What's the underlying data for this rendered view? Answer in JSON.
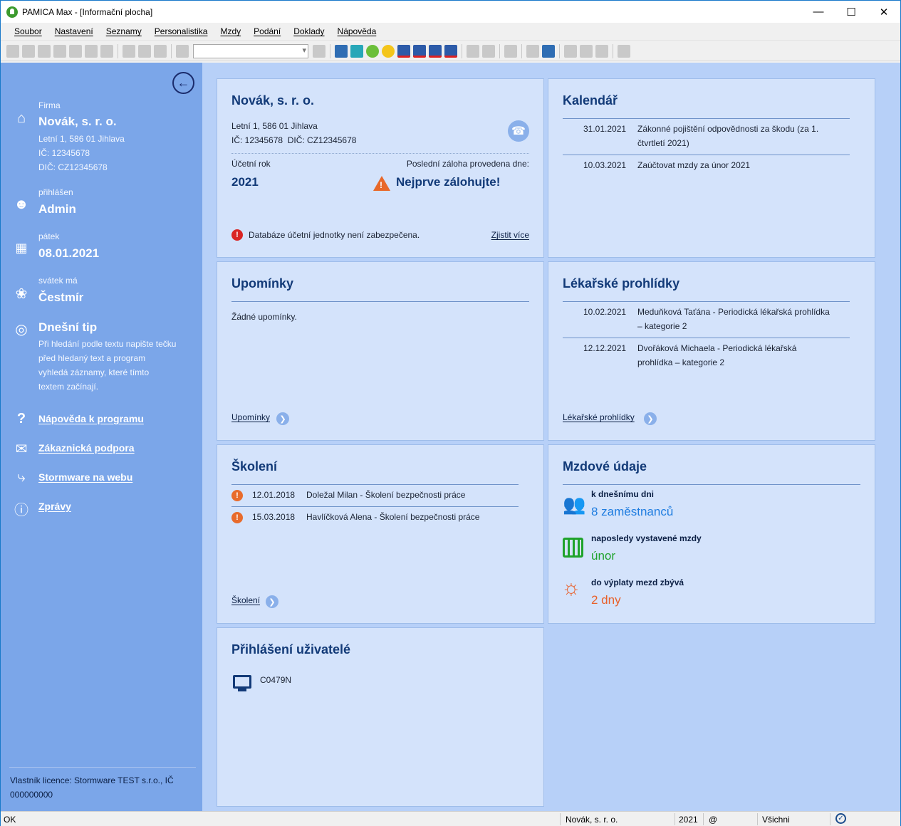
{
  "window": {
    "title": "PAMICA Max - [Informační plocha]",
    "minimize": "—",
    "maximize": "☐",
    "close": "✕"
  },
  "menu": [
    "Soubor",
    "Nastavení",
    "Seznamy",
    "Personalistika",
    "Mzdy",
    "Podání",
    "Doklady",
    "Nápověda"
  ],
  "sidebar": {
    "firm_label": "Firma",
    "firm_name": "Novák, s. r. o.",
    "firm_address": "Letní 1, 586 01 Jihlava",
    "firm_ic": "IČ: 12345678",
    "firm_dic": "DIČ: CZ12345678",
    "user_label": "přihlášen",
    "user_name": "Admin",
    "day_label": "pátek",
    "date": "08.01.2021",
    "nameday_label": "svátek má",
    "nameday": "Čestmír",
    "tip_title": "Dnešní tip",
    "tip_lines": [
      "Při hledání podle textu napište tečku",
      "před hledaný text a program",
      "vyhledá záznamy, které tímto",
      "textem začínají."
    ],
    "links": {
      "help": "Nápověda k programu",
      "support": "Zákaznická podpora",
      "web": "Stormware na webu",
      "news": "Zprávy"
    },
    "license_line1": "Vlastník licence: Stormware TEST s.r.o., IČ",
    "license_line2": "000000000"
  },
  "company_card": {
    "title": "Novák, s. r. o.",
    "address": "Letní 1, 586 01 Jihlava",
    "ids": "IČ: 12345678  DIČ: CZ12345678",
    "year_label": "Účetní rok",
    "year": "2021",
    "backup_label": "Poslední záloha provedena dne:",
    "backup_value": "Nejprve zálohujte!",
    "db_warning": "Databáze účetní jednotky není zabezpečena.",
    "more_link": "Zjistit více"
  },
  "calendar": {
    "title": "Kalendář",
    "items": [
      {
        "date": "31.01.2021",
        "line1": "Zákonné pojištění odpovědnosti za škodu (za 1.",
        "line2": "čtvrtletí 2021)"
      },
      {
        "date": "10.03.2021",
        "line1": "Zaúčtovat mzdy za únor 2021",
        "line2": ""
      }
    ]
  },
  "reminders": {
    "title": "Upomínky",
    "empty": "Žádné upomínky.",
    "link": "Upomínky"
  },
  "medical": {
    "title": "Lékařské prohlídky",
    "items": [
      {
        "date": "10.02.2021",
        "line1": "Meduňková Taťána - Periodická lékařská prohlídka",
        "line2": "– kategorie 2"
      },
      {
        "date": "12.12.2021",
        "line1": "Dvořáková Michaela - Periodická lékařská",
        "line2": "prohlídka – kategorie 2"
      }
    ],
    "link": "Lékařské prohlídky"
  },
  "training": {
    "title": "Školení",
    "items": [
      {
        "date": "12.01.2018",
        "text": "Doležal Milan - Školení bezpečnosti práce"
      },
      {
        "date": "15.03.2018",
        "text": "Havlíčková Alena - Školení bezpečnosti práce"
      }
    ],
    "link": "Školení"
  },
  "payroll": {
    "title": "Mzdové údaje",
    "employees_label": "k dnešnímu dni",
    "employees_value": "8 zaměstnanců",
    "last_label": "naposledy vystavené mzdy",
    "last_value": "únor",
    "payday_label": "do výplaty mezd zbývá",
    "payday_value": "2 dny",
    "colors": {
      "employees": "#1f7de0",
      "last": "#1fa32b",
      "payday": "#e8602a"
    }
  },
  "users": {
    "title": "Přihlášení uživatelé",
    "items": [
      "C0479N"
    ]
  },
  "statusbar": {
    "state": "OK",
    "company": "Novák, s. r. o.",
    "year": "2021",
    "at": "@",
    "filter": "Všichni"
  }
}
